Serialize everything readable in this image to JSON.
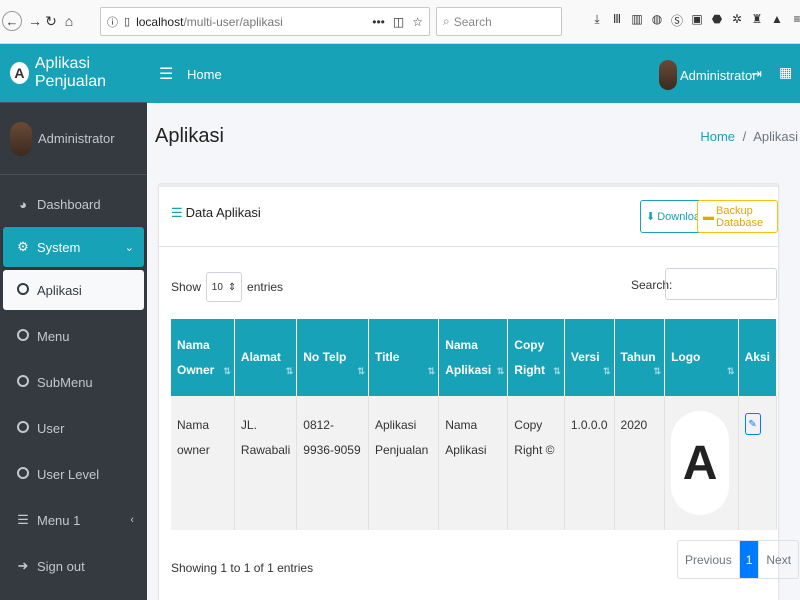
{
  "browser": {
    "url_host": "localhost",
    "url_path": "/multi-user/aplikasi",
    "search_placeholder": "Search",
    "url_menu": "•••"
  },
  "brand": {
    "title": "Aplikasi Penjualan",
    "logo_letter": "A"
  },
  "user_panel": {
    "name": "Administrator"
  },
  "sidebar": {
    "items": [
      {
        "label": "Dashboard",
        "icon": "dashboard-icon"
      },
      {
        "label": "System",
        "icon": "cogs-icon"
      },
      {
        "label": "Aplikasi",
        "icon": "circle-icon"
      },
      {
        "label": "Menu",
        "icon": "circle-icon"
      },
      {
        "label": "SubMenu",
        "icon": "circle-icon"
      },
      {
        "label": "User",
        "icon": "circle-icon"
      },
      {
        "label": "User Level",
        "icon": "circle-icon"
      },
      {
        "label": "Menu 1",
        "icon": "database-icon"
      },
      {
        "label": "Sign out",
        "icon": "sign-out-icon"
      }
    ]
  },
  "topnav": {
    "home": "Home",
    "user": "Administrator"
  },
  "page": {
    "title": "Aplikasi",
    "breadcrumb_home": "Home",
    "breadcrumb_sep": "/",
    "breadcrumb_current": "Aplikasi"
  },
  "card": {
    "title": "Data Aplikasi",
    "download_label": "Download",
    "backup_label": "Backup Database",
    "show_label": "Show",
    "entries_value": "10",
    "entries_label": "entries",
    "search_label": "Search:"
  },
  "table": {
    "headers": [
      "Nama Owner",
      "Alamat",
      "No Telp",
      "Title",
      "Nama Aplikasi",
      "Copy Right",
      "Versi",
      "Tahun",
      "Logo",
      "Aksi"
    ],
    "rows": [
      [
        "Nama owner",
        "JL. Rawabali",
        "0812-9936-9059",
        "Aplikasi Penjualan",
        "Nama Aplikasi",
        "Copy Right ©",
        "1.0.0.0",
        "2020",
        "A",
        ""
      ]
    ]
  },
  "footer": {
    "info": "Showing 1 to 1 of 1 entries",
    "prev": "Previous",
    "page": "1",
    "next": "Next"
  },
  "colors": {
    "accent": "#17a2b8",
    "sidebar": "#343a40",
    "primary": "#007bff",
    "warning": "#ffc107"
  }
}
